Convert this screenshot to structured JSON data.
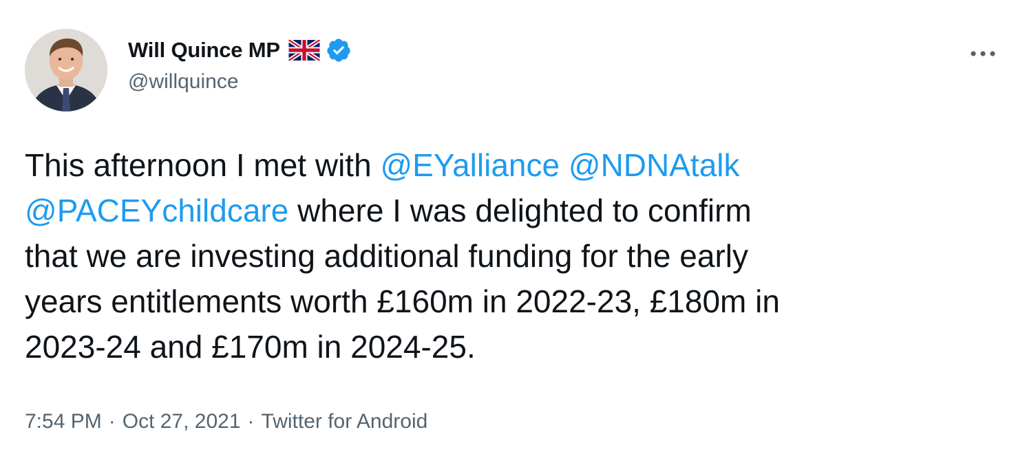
{
  "author": {
    "display_name": "Will Quince MP",
    "handle": "@willquince",
    "flag_icon": "uk-flag-icon",
    "verified_icon": "verified-badge-icon"
  },
  "tweet": {
    "line1_text": "This afternoon I met with ",
    "mention1": "@EYalliance",
    "mention2": "@NDNAtalk",
    "mention3": "@PACEYchildcare",
    "line2_text": " where I was delighted to confirm",
    "line3_text": "that we are investing additional funding for the early",
    "line4_text": "years entitlements worth £160m in 2022-23, £180m in",
    "line5_text": "2023-24 and £170m in 2024-25."
  },
  "meta": {
    "time": "7:54 PM",
    "date": "Oct 27, 2021",
    "separator": "·",
    "source": "Twitter for Android"
  },
  "colors": {
    "link": "#1d9bf0",
    "secondary_text": "#536471",
    "primary_text": "#0f1419"
  }
}
